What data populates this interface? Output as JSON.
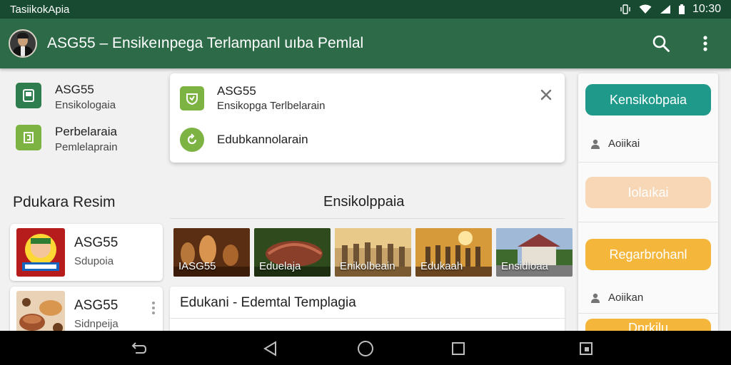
{
  "status_bar": {
    "title": "TasiikokApia",
    "time": "10:30"
  },
  "app_bar": {
    "title": "ASG55 – Ensikeınpega Terlampanl uıba Pemlal"
  },
  "features": [
    {
      "title": "ASG55",
      "subtitle": "Ensikologaia",
      "color": "#2e7d4f"
    },
    {
      "title": "Perbelaraia",
      "subtitle": "Pemlelaprain",
      "color": "#7cb342"
    }
  ],
  "resources": {
    "title": "Pdukara Resim",
    "items": [
      {
        "title": "ASG55",
        "subtitle": "Sdupoia"
      },
      {
        "title": "ASG55",
        "subtitle": "Sidnpeija"
      }
    ]
  },
  "dropdown": {
    "items": [
      {
        "title": "ASG55",
        "subtitle": "Ensikopga Terlbelarain"
      },
      {
        "title": "Edubkannolarain",
        "subtitle": ""
      }
    ]
  },
  "encyclopedia": {
    "title": "Ensikolppaia",
    "gallery": [
      {
        "caption": "IASG55"
      },
      {
        "caption": "Eduelaja"
      },
      {
        "caption": "Enikolbeain"
      },
      {
        "caption": "Edukaah"
      },
      {
        "caption": "Ensidloaa"
      }
    ],
    "list_title": "Edukani - Edemtal Templagia"
  },
  "right_panel": {
    "primary_button": "Kensikobpaia",
    "row1": "Aoiikai",
    "secondary_button": "Iolaıkai",
    "tertiary_button": "Regarbrohanl",
    "row2": "Aoiikan",
    "bottom_button": "Dnrkilu"
  },
  "colors": {
    "status_bar": "#174a30",
    "app_bar": "#2d6b48",
    "teal_button": "#1f9a8a",
    "peach_button": "#f7d7b6",
    "orange_button": "#f5b73b",
    "feature_dark": "#2e7d4f",
    "feature_light": "#7cb342"
  },
  "icons": {
    "search": "search-icon",
    "more": "more-vert-icon",
    "close": "close-icon",
    "back": "back-icon",
    "home": "home-icon",
    "recents": "recents-icon"
  }
}
